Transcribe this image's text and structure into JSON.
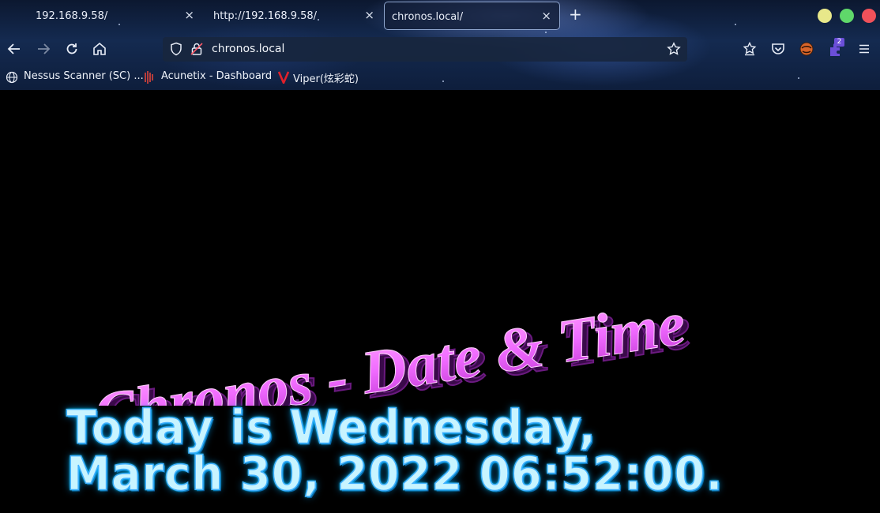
{
  "tabs": [
    {
      "title": "192.168.9.58/",
      "active": false
    },
    {
      "title": "http://192.168.9.58/",
      "active": false
    },
    {
      "title": "chronos.local/",
      "active": true
    }
  ],
  "tab_close_glyph": "×",
  "new_tab_glyph": "+",
  "window_controls": {
    "minimize_color": "#e8e88a",
    "maximize_color": "#5fd86a",
    "close_color": "#f0515a"
  },
  "address": {
    "url": "chronos.local"
  },
  "toolbar": {
    "extension_badge": "2"
  },
  "bookmarks": [
    {
      "label": "Nessus Scanner (SC) ...",
      "icon": "globe-icon"
    },
    {
      "label": "Acunetix - Dashboard",
      "icon": "acunetix-icon"
    },
    {
      "label": "Viper(炫彩蛇)",
      "icon": "viper-v-icon"
    }
  ],
  "page": {
    "heading": "Chronos - Date & Time",
    "date_line_1": "Today is Wednesday,",
    "date_line_2": "March 30, 2022 06:52:00.",
    "heading_color": "#f06bff",
    "date_color": "#69d8ff"
  }
}
